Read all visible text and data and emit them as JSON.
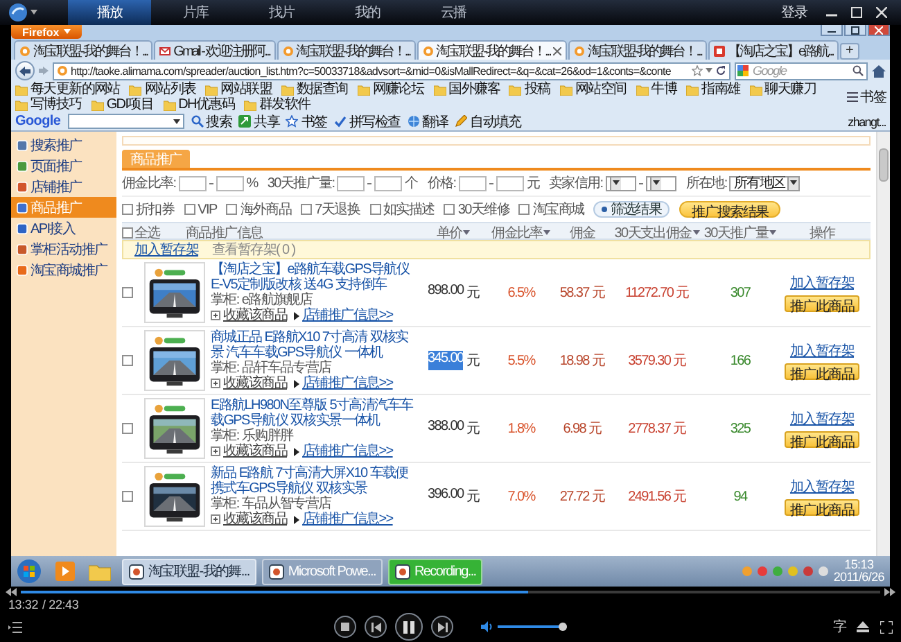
{
  "player": {
    "tabs": [
      {
        "label": "播放",
        "selected": true
      },
      {
        "label": "片库",
        "selected": false
      },
      {
        "label": "找片",
        "selected": false
      },
      {
        "label": "我的",
        "selected": false
      },
      {
        "label": "云播",
        "selected": false
      }
    ],
    "login": "登录"
  },
  "browser": {
    "menu_button": "Firefox",
    "tabs": [
      {
        "title": "淘宝联盟-我的舞台！...",
        "selected": false,
        "kind": "taobao"
      },
      {
        "title": "Gmail - 欢迎注册阿...",
        "selected": false,
        "kind": "gmail"
      },
      {
        "title": "淘宝联盟-我的舞台！...",
        "selected": false,
        "kind": "taobao"
      },
      {
        "title": "淘宝联盟-我的舞台！...",
        "selected": true,
        "kind": "taobao"
      },
      {
        "title": "淘宝联盟-我的舞台！...",
        "selected": false,
        "kind": "taobao"
      },
      {
        "title": "【淘店之宝】e路航...",
        "selected": false,
        "kind": "shop"
      }
    ],
    "new_tab": "+",
    "url": "http://taoke.alimama.com/spreader/auction_list.htm?c=50033718&advsort=&mid=0&isMallRedirect=&q=&cat=26&od=1&conts=&conte",
    "search_placeholder": "Google",
    "bookmarks": [
      "每天更新的网站",
      "网站列表",
      "网站联盟",
      "数据查询",
      "网赚论坛",
      "国外赚客",
      "投稿",
      "网站空间",
      "牛博",
      "指南雄",
      "聊天赚刀",
      "写博技巧",
      "GDI项目",
      "DH优惠码",
      "群发软件"
    ],
    "bookmarks_menu": "书签",
    "toolbar": {
      "logo": "Google",
      "items": [
        {
          "label": "搜索"
        },
        {
          "label": "共享"
        },
        {
          "label": "书签"
        },
        {
          "label": "拼写检查"
        },
        {
          "label": "翻译"
        },
        {
          "label": "自动填充"
        }
      ],
      "user": "zhangt..."
    }
  },
  "sidebar": {
    "items": [
      {
        "label": "搜索推广",
        "selected": false
      },
      {
        "label": "页面推广",
        "selected": false
      },
      {
        "label": "店铺推广",
        "selected": false
      },
      {
        "label": "商品推广",
        "selected": true
      },
      {
        "label": "API接入",
        "selected": false
      },
      {
        "label": "掌柜活动推广",
        "selected": false
      },
      {
        "label": "淘宝商城推广",
        "selected": false
      }
    ]
  },
  "section_tab": "商品推广",
  "filters": [
    {
      "label": "佣金比率:",
      "kind": "range",
      "unit": "%"
    },
    {
      "label": "30天推广量:",
      "kind": "range",
      "unit": "个"
    },
    {
      "label": "价格:",
      "kind": "range",
      "unit": "元"
    },
    {
      "label": "卖家信用:",
      "kind": "select_range"
    },
    {
      "label": "所在地:",
      "kind": "select",
      "value": "所有地区"
    }
  ],
  "options": [
    {
      "label": "折扣券",
      "checked": false
    },
    {
      "label": "VIP",
      "checked": false
    },
    {
      "label": "海外商品",
      "checked": false
    },
    {
      "label": "7天退换",
      "checked": false
    },
    {
      "label": "如实描述",
      "checked": false
    },
    {
      "label": "30天维修",
      "checked": false
    },
    {
      "label": "淘宝商城",
      "checked": false
    }
  ],
  "buttons": {
    "filter": "筛选结果",
    "promote": "推广搜索结果"
  },
  "table": {
    "select_all": {
      "label": "全选",
      "checked": false
    },
    "columns": [
      {
        "label": "商品推广信息",
        "sortable": false
      },
      {
        "label": "单价",
        "sortable": true
      },
      {
        "label": "佣金比率",
        "sortable": true
      },
      {
        "label": "佣金",
        "sortable": false
      },
      {
        "label": "30天支出佣金",
        "sortable": true
      },
      {
        "label": "30天推广量",
        "sortable": true
      },
      {
        "label": "操作",
        "sortable": false
      }
    ],
    "staging": {
      "add": "加入暂存架",
      "view": "查看暂存架( 0 )"
    },
    "rows": [
      {
        "checked": false,
        "title": "【淘店之宝】e路航车载GPS导航仪 E-V5定制版改核 送4G 支持倒车",
        "shop": "掌柜: e路航旗舰店",
        "favorite": "收藏该商品",
        "shop_info": "店铺推广信息>>",
        "price": "898.00",
        "price_highlighted": false,
        "unit": "元",
        "rate": "6.5%",
        "commission": "58.37 元",
        "spend": "11272.70 元",
        "count": "307",
        "add": "加入暂存架",
        "promote": "推广此商品"
      },
      {
        "checked": false,
        "title": "商城正品 E路航X10 7寸高清 双核实景 汽车车载GPS导航仪 一体机",
        "shop": "掌柜: 品轩车品专营店",
        "favorite": "收藏该商品",
        "shop_info": "店铺推广信息>>",
        "price": "345.00",
        "price_highlighted": true,
        "unit": "元",
        "rate": "5.5%",
        "commission": "18.98 元",
        "spend": "3579.30 元",
        "count": "166",
        "add": "加入暂存架",
        "promote": "推广此商品"
      },
      {
        "checked": false,
        "title": "E路航LH980N至尊版 5寸高清汽车车载GPS导航仪 双核实景一体机",
        "shop": "掌柜: 乐购胖胖",
        "favorite": "收藏该商品",
        "shop_info": "店铺推广信息>>",
        "price": "388.00",
        "price_highlighted": false,
        "unit": "元",
        "rate": "1.8%",
        "commission": "6.98 元",
        "spend": "2778.37 元",
        "count": "325",
        "add": "加入暂存架",
        "promote": "推广此商品"
      },
      {
        "checked": false,
        "title": "新品 E路航 7寸高清大屏X10 车载便携式车GPS导航仪 双核实景",
        "shop": "掌柜: 车品从智专营店",
        "favorite": "收藏该商品",
        "shop_info": "店铺推广信息>>",
        "price": "396.00",
        "price_highlighted": false,
        "unit": "元",
        "rate": "7.0%",
        "commission": "27.72 元",
        "spend": "2491.56 元",
        "count": "94",
        "add": "加入暂存架",
        "promote": "推广此商品"
      }
    ]
  },
  "taskbar": {
    "items": [
      {
        "label": "淘宝联盟-我的舞...",
        "color": "#c5d3e4"
      },
      {
        "label": "Microsoft Powe...",
        "color": "#8fa3bd"
      },
      {
        "label": "Recording...",
        "color": "#36b336"
      }
    ],
    "time": "15:13",
    "date": "2011/6/26"
  },
  "playback": {
    "level": 0.59,
    "elapsed": "13:32",
    "total": "/ 22:43",
    "subtitle": "字",
    "volume": {
      "level": 1
    }
  }
}
